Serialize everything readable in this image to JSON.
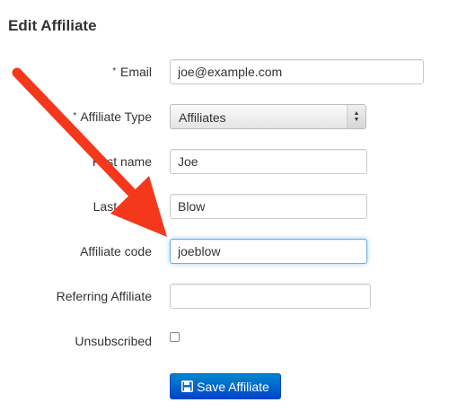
{
  "page": {
    "title": "Edit Affiliate"
  },
  "form": {
    "required_marker": "*",
    "email": {
      "label": "Email",
      "value": "joe@example.com"
    },
    "affiliate_type": {
      "label": "Affiliate Type",
      "value": "Affiliates"
    },
    "first_name": {
      "label": "First name",
      "value": "Joe"
    },
    "last_name": {
      "label": "Last name",
      "value": "Blow"
    },
    "affiliate_code": {
      "label": "Affiliate code",
      "value": "joeblow"
    },
    "referring_affiliate": {
      "label": "Referring Affiliate",
      "value": ""
    },
    "unsubscribed": {
      "label": "Unsubscribed",
      "checked": false
    },
    "save_label": "Save Affiliate"
  },
  "annotation": {
    "color": "#f5381c",
    "icon": "red-arrow-annotation"
  },
  "colors": {
    "button": "#0055cc",
    "focus_border": "#66afe9"
  }
}
